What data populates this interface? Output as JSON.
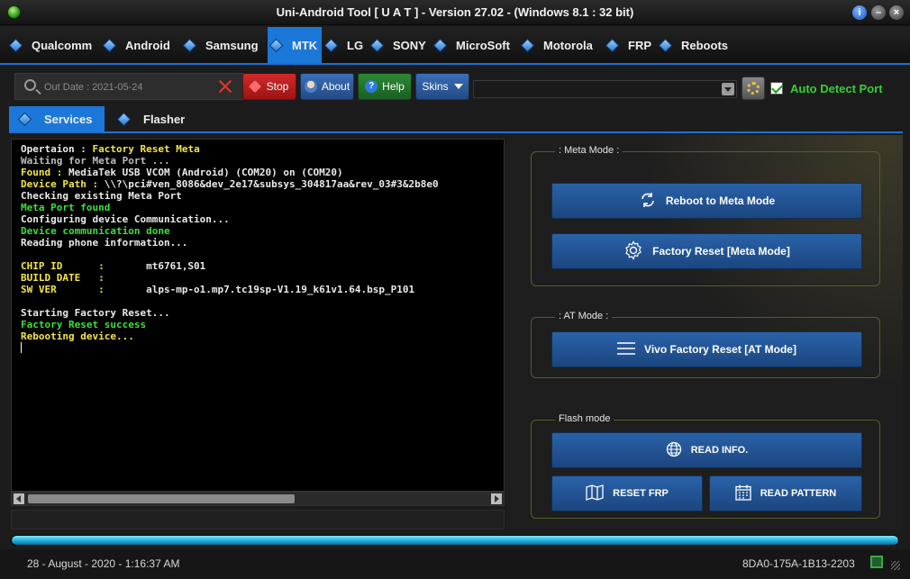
{
  "window": {
    "title": "Uni-Android Tool [ U A T ] - Version 27.02  -  (Windows 8.1  : 32 bit)"
  },
  "menu": {
    "items": [
      {
        "label": "Qualcomm"
      },
      {
        "label": "Android"
      },
      {
        "label": "Samsung"
      },
      {
        "label": "MTK",
        "active": true
      },
      {
        "label": "LG"
      },
      {
        "label": "SONY"
      },
      {
        "label": "MicroSoft"
      },
      {
        "label": "Motorola"
      },
      {
        "label": "FRP"
      },
      {
        "label": "Reboots"
      }
    ]
  },
  "toolbar": {
    "search_placeholder": "Out Date : 2021-05-24",
    "stop_label": "Stop",
    "about_label": "About",
    "help_label": "Help",
    "skins_label": "Skins",
    "port_value": "",
    "auto_detect_label": "Auto Detect Port",
    "auto_detect_checked": true
  },
  "tabs": [
    {
      "label": "Services",
      "active": true
    },
    {
      "label": "Flasher"
    }
  ],
  "log": [
    {
      "parts": [
        {
          "text": "Opertaion : ",
          "color": "white"
        },
        {
          "text": "Factory Reset Meta",
          "color": "yellow"
        }
      ]
    },
    {
      "parts": [
        {
          "text": "Waiting for Meta Port ...",
          "color": "gray"
        }
      ]
    },
    {
      "parts": [
        {
          "text": "Found : ",
          "color": "yellow"
        },
        {
          "text": "MediaTek USB VCOM (Android) (COM20) on (COM20)",
          "color": "white"
        }
      ]
    },
    {
      "parts": [
        {
          "text": "Device Path : ",
          "color": "yellow"
        },
        {
          "text": "\\\\?\\pci#ven_8086&dev_2e17&subsys_304817aa&rev_03#3&2b8e0",
          "color": "white"
        }
      ]
    },
    {
      "parts": [
        {
          "text": "Checking existing Meta Port",
          "color": "white"
        }
      ]
    },
    {
      "parts": [
        {
          "text": "Meta Port found",
          "color": "green"
        }
      ]
    },
    {
      "parts": [
        {
          "text": "Configuring device Communication...",
          "color": "white"
        }
      ]
    },
    {
      "parts": [
        {
          "text": "Device communication done",
          "color": "green"
        }
      ]
    },
    {
      "parts": [
        {
          "text": "Reading phone information...",
          "color": "white"
        }
      ]
    },
    {
      "parts": []
    },
    {
      "parts": [
        {
          "text": "CHIP ID      :       ",
          "color": "yellow"
        },
        {
          "text": "mt6761,S01",
          "color": "white"
        }
      ]
    },
    {
      "parts": [
        {
          "text": "BUILD DATE   :",
          "color": "yellow"
        }
      ]
    },
    {
      "parts": [
        {
          "text": "SW VER       :       ",
          "color": "yellow"
        },
        {
          "text": "alps-mp-o1.mp7.tc19sp-V1.19_k61v1.64.bsp_P101",
          "color": "white"
        }
      ]
    },
    {
      "parts": []
    },
    {
      "parts": [
        {
          "text": "Starting Factory Reset...",
          "color": "white"
        }
      ]
    },
    {
      "parts": [
        {
          "text": "Factory Reset success",
          "color": "green"
        }
      ]
    },
    {
      "parts": [
        {
          "text": "Rebooting device...",
          "color": "yellow"
        }
      ]
    }
  ],
  "meta_mode": {
    "group_label": ": Meta Mode :",
    "reboot_label": "Reboot to Meta Mode",
    "factory_reset_label": "Factory Reset [Meta Mode]"
  },
  "at_mode": {
    "group_label": ": AT Mode :",
    "vivo_reset_label": "Vivo Factory Reset [AT Mode]"
  },
  "flash_mode": {
    "group_label": "Flash mode",
    "read_info_label": "READ INFO.",
    "reset_frp_label": "RESET FRP",
    "read_pattern_label": "READ PATTERN"
  },
  "progress": {
    "value": 1.0
  },
  "status": {
    "datetime": "28 - August - 2020  -  1:16:37 AM",
    "id": "8DA0-175A-1B13-2203"
  },
  "colors": {
    "accent": "#1b78d8",
    "log_yellow": "#f4e64a",
    "log_green": "#3ce03c",
    "auto_detect": "#35d035"
  }
}
